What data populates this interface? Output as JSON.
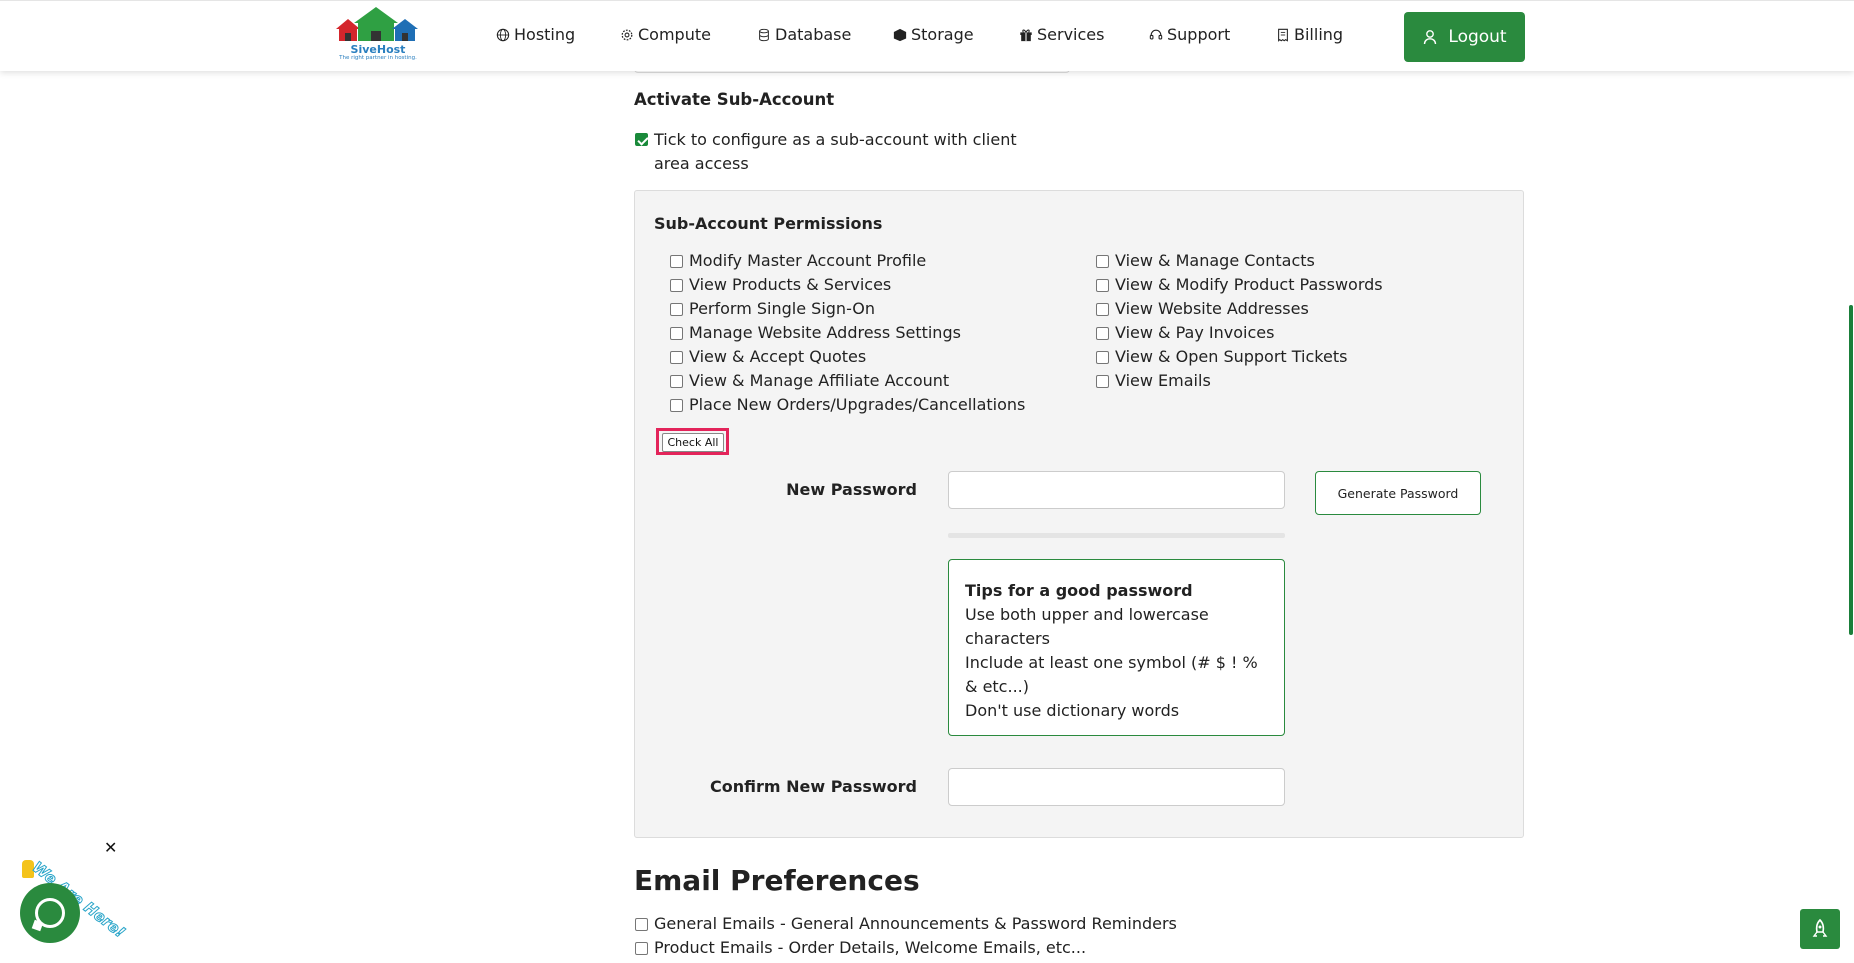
{
  "header": {
    "logo": {
      "name": "SiveHost",
      "tagline": "The right partner in hosting."
    },
    "nav": [
      {
        "label": "Hosting",
        "icon": "globe-icon"
      },
      {
        "label": "Compute",
        "icon": "gear-icon"
      },
      {
        "label": "Database",
        "icon": "database-icon"
      },
      {
        "label": "Storage",
        "icon": "box-icon"
      },
      {
        "label": "Services",
        "icon": "gift-icon"
      },
      {
        "label": "Support",
        "icon": "headset-icon"
      },
      {
        "label": "Billing",
        "icon": "receipt-icon"
      }
    ],
    "logout_label": "Logout"
  },
  "subaccount": {
    "heading": "Activate Sub-Account",
    "activate_label": "Tick to configure as a sub-account with client area access",
    "activate_checked": true
  },
  "permissions": {
    "heading": "Sub-Account Permissions",
    "left": [
      "Modify Master Account Profile",
      "View Products & Services",
      "Perform Single Sign-On",
      "Manage Website Address Settings",
      "View & Accept Quotes",
      "View & Manage Affiliate Account",
      "Place New Orders/Upgrades/Cancellations"
    ],
    "right": [
      "View & Manage Contacts",
      "View & Modify Product Passwords",
      "View Website Addresses",
      "View & Pay Invoices",
      "View & Open Support Tickets",
      "View Emails"
    ],
    "check_all_label": "Check All"
  },
  "password": {
    "new_label": "New Password",
    "new_value": "",
    "generate_label": "Generate Password",
    "tips_title": "Tips for a good password",
    "tips": [
      "Use both upper and lowercase characters",
      "Include at least one symbol (# $ ! % & etc...)",
      "Don't use dictionary words"
    ],
    "confirm_label": "Confirm New Password",
    "confirm_value": ""
  },
  "email_prefs": {
    "heading": "Email Preferences",
    "items": [
      "General Emails - General Announcements & Password Reminders",
      "Product Emails - Order Details, Welcome Emails, etc..."
    ]
  },
  "chat_widget": {
    "text": "We Are Here!",
    "close": "✕"
  },
  "colors": {
    "brand_green": "#2a8a3e",
    "highlight_red": "#e3245a"
  }
}
